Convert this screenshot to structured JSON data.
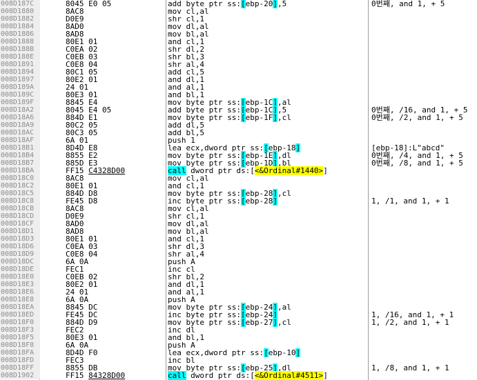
{
  "rows": [
    {
      "addr": "008D187C",
      "bytes": "8045 E0 05",
      "ins": "add byte ptr ss:[ebp-20],5",
      "cmt": "0번째, and 1, + 5"
    },
    {
      "addr": "008D1880",
      "bytes": "8AC8",
      "ins": "mov cl,al",
      "cmt": ""
    },
    {
      "addr": "008D1882",
      "bytes": "D0E9",
      "ins": "shr cl,1",
      "cmt": ""
    },
    {
      "addr": "008D1884",
      "bytes": "8AD0",
      "ins": "mov dl,al",
      "cmt": ""
    },
    {
      "addr": "008D1886",
      "bytes": "8AD8",
      "ins": "mov bl,al",
      "cmt": ""
    },
    {
      "addr": "008D1888",
      "bytes": "80E1 01",
      "ins": "and cl,1",
      "cmt": ""
    },
    {
      "addr": "008D188B",
      "bytes": "C0EA 02",
      "ins": "shr dl,2",
      "cmt": ""
    },
    {
      "addr": "008D188E",
      "bytes": "C0EB 03",
      "ins": "shr bl,3",
      "cmt": ""
    },
    {
      "addr": "008D1891",
      "bytes": "C0E8 04",
      "ins": "shr al,4",
      "cmt": ""
    },
    {
      "addr": "008D1894",
      "bytes": "80C1 05",
      "ins": "add cl,5",
      "cmt": ""
    },
    {
      "addr": "008D1897",
      "bytes": "80E2 01",
      "ins": "and dl,1",
      "cmt": ""
    },
    {
      "addr": "008D189A",
      "bytes": "24 01",
      "ins": "and al,1",
      "cmt": ""
    },
    {
      "addr": "008D189C",
      "bytes": "80E3 01",
      "ins": "and bl,1",
      "cmt": ""
    },
    {
      "addr": "008D189F",
      "bytes": "8845 E4",
      "ins": "mov byte ptr ss:[ebp-1C],al",
      "cmt": ""
    },
    {
      "addr": "008D18A2",
      "bytes": "8045 E4 05",
      "ins": "add byte ptr ss:[ebp-1C],5",
      "cmt": "0번째, /16, and 1, + 5"
    },
    {
      "addr": "008D18A6",
      "bytes": "884D E1",
      "ins": "mov byte ptr ss:[ebp-1F],cl",
      "cmt": "0번째, /2, and 1, + 5"
    },
    {
      "addr": "008D18A9",
      "bytes": "80C2 05",
      "ins": "add dl,5",
      "cmt": ""
    },
    {
      "addr": "008D18AC",
      "bytes": "80C3 05",
      "ins": "add bl,5",
      "cmt": ""
    },
    {
      "addr": "008D18AF",
      "bytes": "6A 01",
      "ins": "push 1",
      "cmt": ""
    },
    {
      "addr": "008D18B1",
      "bytes": "8D4D E8",
      "ins": "lea ecx,dword ptr ss:[ebp-18]",
      "cmt": "[ebp-18]:L\"abcd\""
    },
    {
      "addr": "008D18B4",
      "bytes": "8855 E2",
      "ins": "mov byte ptr ss:[ebp-1E],dl",
      "cmt": "0번째, /4, and 1, + 5"
    },
    {
      "addr": "008D18B7",
      "bytes": "885D E3",
      "ins": "mov byte ptr ss:[ebp-1D],bl",
      "cmt": "0번째, /8, and 1, + 5"
    },
    {
      "addr": "008D18BA",
      "bytes": "FF15 C4328D00",
      "ins": "call dword ptr ds:[<&Ordinal#1440>]",
      "cmt": ""
    },
    {
      "addr": "008D18C0",
      "bytes": "8AC8",
      "ins": "mov cl,al",
      "cmt": ""
    },
    {
      "addr": "008D18C2",
      "bytes": "80E1 01",
      "ins": "and cl,1",
      "cmt": ""
    },
    {
      "addr": "008D18C5",
      "bytes": "884D D8",
      "ins": "mov byte ptr ss:[ebp-28],cl",
      "cmt": ""
    },
    {
      "addr": "008D18C8",
      "bytes": "FE45 D8",
      "ins": "inc byte ptr ss:[ebp-28]",
      "cmt": "1, /1, and 1, + 1"
    },
    {
      "addr": "008D18CB",
      "bytes": "8AC8",
      "ins": "mov cl,al",
      "cmt": ""
    },
    {
      "addr": "008D18CD",
      "bytes": "D0E9",
      "ins": "shr cl,1",
      "cmt": ""
    },
    {
      "addr": "008D18CF",
      "bytes": "8AD0",
      "ins": "mov dl,al",
      "cmt": ""
    },
    {
      "addr": "008D18D1",
      "bytes": "8AD8",
      "ins": "mov bl,al",
      "cmt": ""
    },
    {
      "addr": "008D18D3",
      "bytes": "80E1 01",
      "ins": "and cl,1",
      "cmt": ""
    },
    {
      "addr": "008D18D6",
      "bytes": "C0EA 03",
      "ins": "shr dl,3",
      "cmt": ""
    },
    {
      "addr": "008D18D9",
      "bytes": "C0E8 04",
      "ins": "shr al,4",
      "cmt": ""
    },
    {
      "addr": "008D18DC",
      "bytes": "6A 0A",
      "ins": "push A",
      "cmt": ""
    },
    {
      "addr": "008D18DE",
      "bytes": "FEC1",
      "ins": "inc cl",
      "cmt": ""
    },
    {
      "addr": "008D18E0",
      "bytes": "C0EB 02",
      "ins": "shr bl,2",
      "cmt": ""
    },
    {
      "addr": "008D18E3",
      "bytes": "80E2 01",
      "ins": "and dl,1",
      "cmt": ""
    },
    {
      "addr": "008D18E6",
      "bytes": "24 01",
      "ins": "and al,1",
      "cmt": ""
    },
    {
      "addr": "008D18E8",
      "bytes": "6A 0A",
      "ins": "push A",
      "cmt": ""
    },
    {
      "addr": "008D18EA",
      "bytes": "8845 DC",
      "ins": "mov byte ptr ss:[ebp-24],al",
      "cmt": ""
    },
    {
      "addr": "008D18ED",
      "bytes": "FE45 DC",
      "ins": "inc byte ptr ss:[ebp-24]",
      "cmt": "1, /16, and 1, + 1"
    },
    {
      "addr": "008D18F0",
      "bytes": "884D D9",
      "ins": "mov byte ptr ss:[ebp-27],cl",
      "cmt": "1, /2, and 1, + 1"
    },
    {
      "addr": "008D18F3",
      "bytes": "FEC2",
      "ins": "inc dl",
      "cmt": ""
    },
    {
      "addr": "008D18F5",
      "bytes": "80E3 01",
      "ins": "and bl,1",
      "cmt": ""
    },
    {
      "addr": "008D18F8",
      "bytes": "6A 0A",
      "ins": "push A",
      "cmt": ""
    },
    {
      "addr": "008D18FA",
      "bytes": "8D4D F0",
      "ins": "lea ecx,dword ptr ss:[ebp-10]",
      "cmt": ""
    },
    {
      "addr": "008D18FD",
      "bytes": "FEC3",
      "ins": "inc bl",
      "cmt": ""
    },
    {
      "addr": "008D18FF",
      "bytes": "8855 DB",
      "ins": "mov byte ptr ss:[ebp-25],dl",
      "cmt": "1, /8, and 1, + 1"
    },
    {
      "addr": "008D1902",
      "bytes": "FF15 84328D00",
      "ins": "call dword ptr ds:[<&Ordinal#4511>]",
      "cmt": ""
    }
  ],
  "colors": {
    "address_bg": "#eeeeee",
    "address_fg": "#8c8c8c",
    "operand_highlight": "#00ffff",
    "import_highlight": "#ffff00",
    "keyword": "#000080"
  }
}
